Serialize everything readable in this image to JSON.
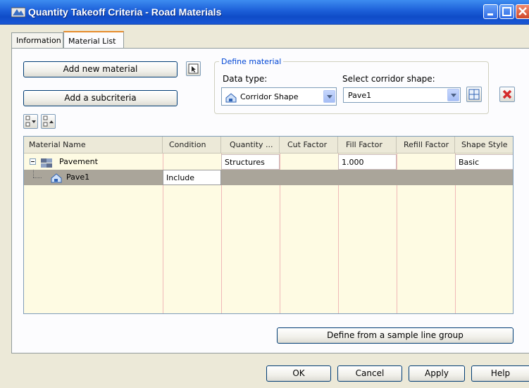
{
  "window": {
    "title": "Quantity Takeoff Criteria - Road  Materials"
  },
  "tabs": [
    {
      "label": "Information",
      "active": false
    },
    {
      "label": "Material List",
      "active": true
    }
  ],
  "actions": {
    "add_material": "Add new material",
    "add_subcriteria": "Add a subcriteria"
  },
  "define_material": {
    "legend": "Define material",
    "data_type_label": "Data type:",
    "data_type_value": "Corridor Shape",
    "shape_label": "Select corridor shape:",
    "shape_value": "Pave1"
  },
  "table": {
    "columns": [
      "Material Name",
      "Condition",
      "Quantity ...",
      "Cut Factor",
      "Fill Factor",
      "Refill Factor",
      "Shape Style"
    ],
    "rows": [
      {
        "name": "Pavement",
        "condition": "",
        "quantity": "Structures",
        "cut": "",
        "fill": "1.000",
        "refill": "",
        "style": "Basic"
      },
      {
        "name": "Pave1",
        "condition": "Include",
        "quantity": "",
        "cut": "",
        "fill": "",
        "refill": "",
        "style": ""
      }
    ]
  },
  "define_sample_button": "Define from a sample line group",
  "footer": {
    "ok": "OK",
    "cancel": "Cancel",
    "apply": "Apply",
    "help": "Help"
  },
  "colors": {
    "titlebar": "#1c5fd8",
    "selected_row": "#aaa59a",
    "grid_bg": "#fefbe3",
    "remove_icon": "#d42a2a"
  }
}
